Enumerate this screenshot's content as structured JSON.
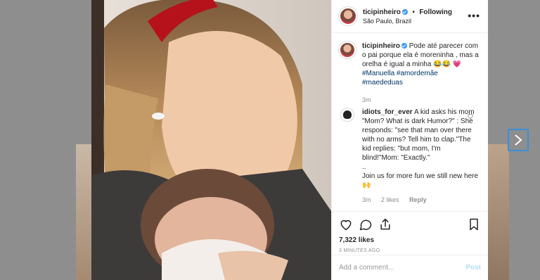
{
  "post": {
    "username": "ticipinheiro",
    "follow_label": "Following",
    "location": "São Paulo, Brazil",
    "more_label": "•••"
  },
  "caption": {
    "username": "ticipinheiro",
    "text": "Pode até parecer com o pai porque ela é moreninha , mas a orelha é igual a minha 😂😂 💗",
    "tags": "#Manuella #amordemãe #maededuas",
    "age": "3m"
  },
  "comment": {
    "username": "idiots_for_ever",
    "text": "A kid asks his mom \"Mom? What is dark Humor?\" : She responds: \"see that man over there with no arms? Tell him to clap.\"The kid replies: \"but mom, I'm blind!\"Mom: \"Exactly.\"",
    "text2": "..",
    "text3": "Join us for more fun we still new here🙌",
    "age": "3m",
    "likes": "2 likes",
    "reply_label": "Reply"
  },
  "engagement": {
    "likes": "7,322 likes",
    "timestamp": "3 MINUTES AGO"
  },
  "compose": {
    "placeholder": "Add a comment...",
    "post_label": "Post"
  },
  "icons": {
    "like": "heart-icon",
    "comment": "comment-icon",
    "share": "share-icon",
    "save": "bookmark-icon",
    "next": "chevron-right-icon"
  },
  "colors": {
    "link": "#003569",
    "verified": "#3897f0",
    "post_disabled": "#b2dffc",
    "next_border": "#3a8fd6"
  }
}
